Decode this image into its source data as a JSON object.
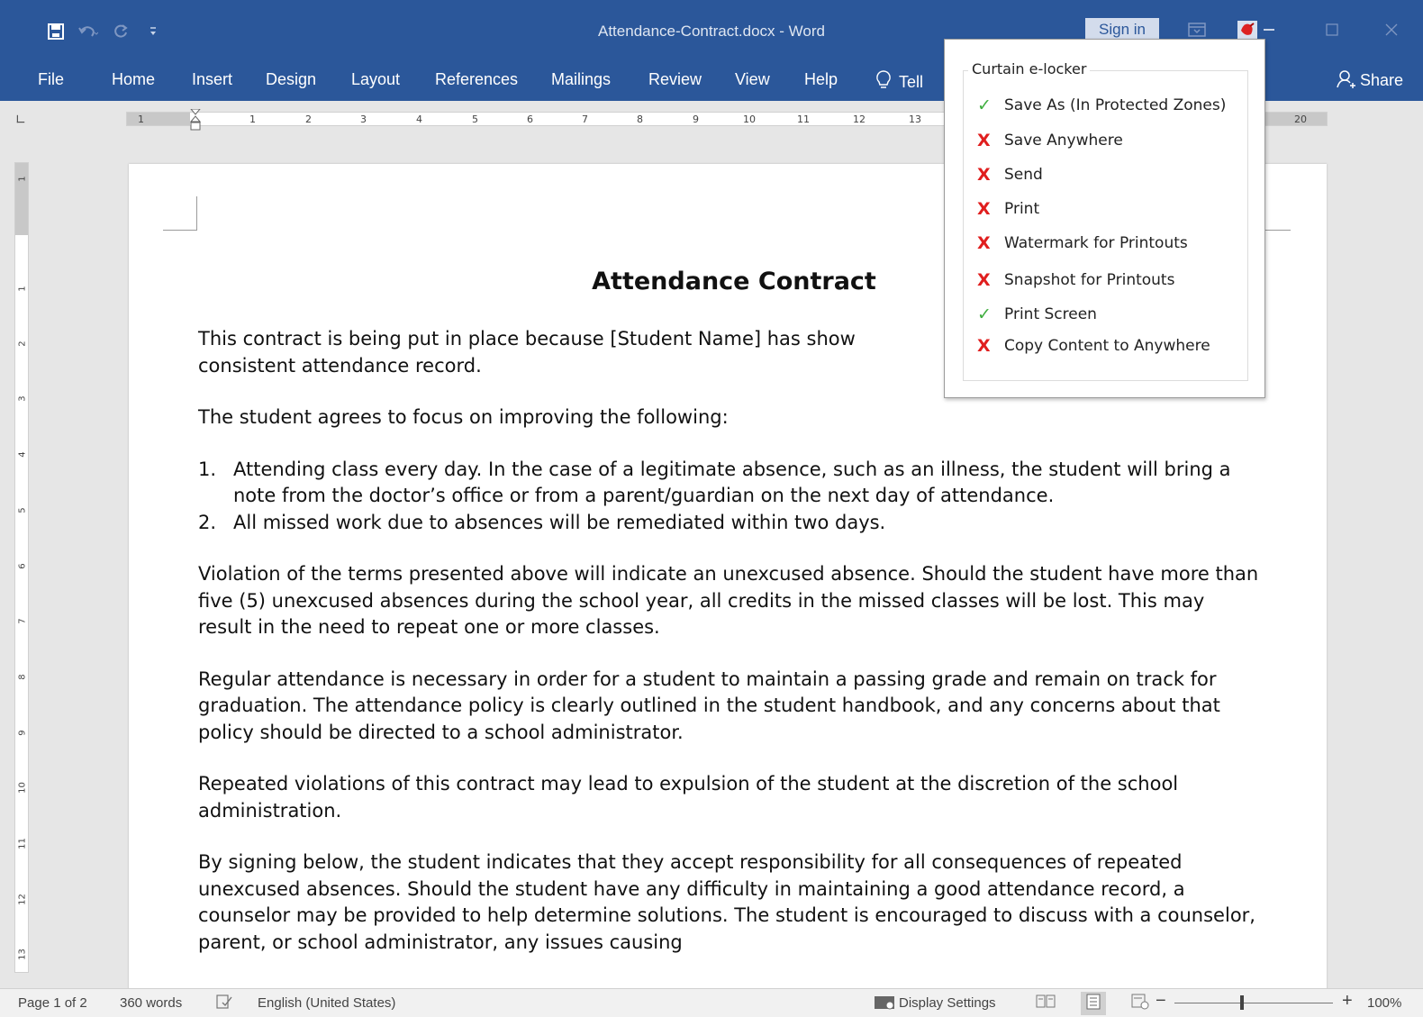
{
  "window": {
    "title": "Attendance-Contract.docx  -  Word",
    "sign_in": "Sign in"
  },
  "qat": {
    "save_icon": "save-icon",
    "undo_icon": "undo-icon",
    "redo_icon": "redo-icon",
    "customize_icon": "customize-qat-icon"
  },
  "ribbon": {
    "tabs": [
      "File",
      "Home",
      "Insert",
      "Design",
      "Layout",
      "References",
      "Mailings",
      "Review",
      "View",
      "Help"
    ],
    "tell_me": "Tell",
    "share": "Share"
  },
  "ruler": {
    "h_ticks": [
      "1",
      "1",
      "2",
      "3",
      "4",
      "5",
      "6",
      "7",
      "8",
      "9",
      "10",
      "11",
      "12",
      "13",
      "20"
    ],
    "v_ticks": [
      "1",
      "1",
      "2",
      "3",
      "4",
      "5",
      "6",
      "7",
      "8",
      "9",
      "10",
      "11",
      "12",
      "13"
    ]
  },
  "document": {
    "title": "Attendance Contract",
    "para1": "This contract is being put in place because [Student Name] has show consistent attendance record.",
    "para1_line1": "This contract is being put in place because [Student Name] has show",
    "para1_line2": "consistent attendance record.",
    "para2": "The student agrees to focus on improving the following:",
    "list": [
      {
        "num": "1.",
        "text": "Attending class every day. In the case of a legitimate absence, such as an illness, the student will bring a note from the doctor’s office or from a parent/guardian on the next day of attendance."
      },
      {
        "num": "2.",
        "text": "All missed work due to absences will be remediated within two days."
      }
    ],
    "para3": "Violation of the terms presented above will indicate an unexcused absence. Should the student have more than five (5) unexcused absences during the school year, all credits in the missed classes will be lost. This may result in the need to repeat one or more classes.",
    "para4": "Regular attendance is necessary in order for a student to maintain a passing grade and remain on track for graduation. The attendance policy is clearly outlined in the student handbook, and any concerns about that policy should be directed to a school administrator.",
    "para5": "Repeated violations of this contract may lead to expulsion of the student at the discretion of the school administration.",
    "para6": "By signing below, the student indicates that they accept responsibility for all consequences of repeated unexcused absences. Should the student have any difficulty in maintaining a good attendance record, a counselor may be provided to help determine solutions. The student is encouraged to discuss with a counselor, parent, or school administrator, any issues causing"
  },
  "locker": {
    "title": "Curtain e-locker",
    "options": [
      {
        "label": "Save As (In Protected Zones)",
        "allowed": true
      },
      {
        "label": "Save Anywhere",
        "allowed": false
      },
      {
        "label": "Send",
        "allowed": false
      },
      {
        "label": "Print",
        "allowed": false
      },
      {
        "label": "Watermark for Printouts",
        "allowed": false
      },
      {
        "label": "Snapshot for Printouts",
        "allowed": false
      },
      {
        "label": "Print Screen",
        "allowed": true
      },
      {
        "label": "Copy Content to Anywhere",
        "allowed": false
      }
    ],
    "check_glyph": "✓",
    "cross_glyph": "X",
    "colors": {
      "allowed": "#3fae3f",
      "denied": "#e01e1e"
    }
  },
  "status": {
    "page": "Page 1 of 2",
    "words": "360 words",
    "language": "English (United States)",
    "display_settings": "Display Settings",
    "zoom": "100%",
    "zoom_minus": "−",
    "zoom_plus": "+",
    "zoom_level": 1.0
  },
  "colors": {
    "ribbon": "#2b579a"
  }
}
